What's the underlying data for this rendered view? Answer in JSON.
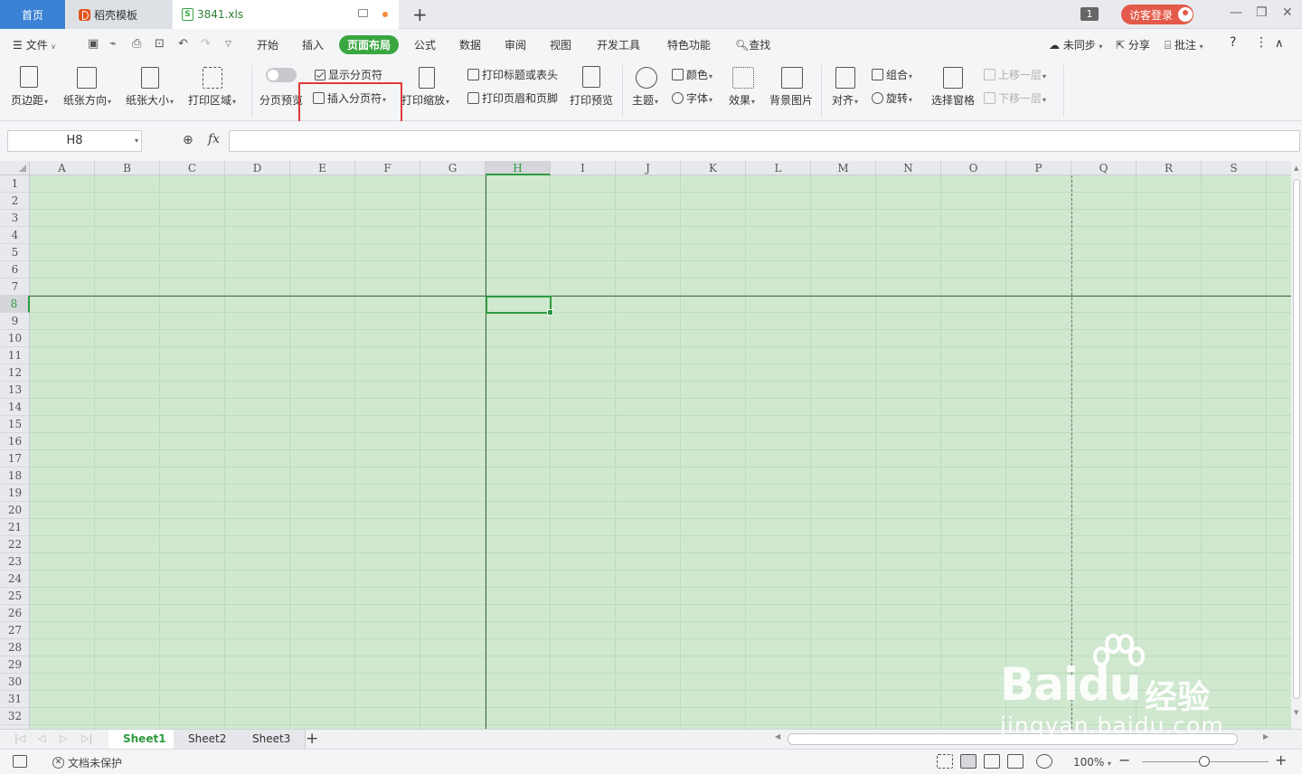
{
  "tabs": {
    "home": "首页",
    "template": "稻壳模板",
    "document": "3841.xls",
    "window_count": "1",
    "login": "访客登录"
  },
  "menu": {
    "file": "文件",
    "items": [
      "开始",
      "插入",
      "页面布局",
      "公式",
      "数据",
      "审阅",
      "视图",
      "开发工具",
      "特色功能",
      "查找"
    ],
    "active": "页面布局",
    "right": [
      "未同步",
      "分享",
      "批注"
    ]
  },
  "ribbon": {
    "margins": "页边距",
    "orientation": "纸张方向",
    "size": "纸张大小",
    "print_area": "打印区域",
    "page_break_preview": "分页预览",
    "show_page_break": "显示分页符",
    "insert_page_break": "插入分页符",
    "print_scale": "打印缩放",
    "print_titles": "打印标题或表头",
    "header_footer": "打印页眉和页脚",
    "print_preview": "打印预览",
    "theme": "主题",
    "colors": "颜色",
    "fonts": "字体",
    "effects": "效果",
    "background": "背景图片",
    "align": "对齐",
    "group": "组合",
    "rotate": "旋转",
    "selection_pane": "选择窗格",
    "bring_forward": "上移一层",
    "send_backward": "下移一层"
  },
  "formula_bar": {
    "name_box": "H8",
    "fx": "fx",
    "value": ""
  },
  "grid": {
    "columns": [
      "A",
      "B",
      "C",
      "D",
      "E",
      "F",
      "G",
      "H",
      "I",
      "J",
      "K",
      "L",
      "M",
      "N",
      "O",
      "P",
      "Q",
      "R",
      "S"
    ],
    "rows": [
      "1",
      "2",
      "3",
      "4",
      "5",
      "6",
      "7",
      "8",
      "9",
      "10",
      "11",
      "12",
      "13",
      "14",
      "15",
      "16",
      "17",
      "18",
      "19",
      "20",
      "21",
      "22",
      "23",
      "24",
      "25",
      "26",
      "27",
      "28",
      "29",
      "30",
      "31",
      "32"
    ],
    "active_col": "H",
    "active_row": "8",
    "background_color": "#cfe8cf",
    "accent_color": "#2e9a3e"
  },
  "sheets": {
    "tabs": [
      "Sheet1",
      "Sheet2",
      "Sheet3"
    ],
    "active": "Sheet1"
  },
  "status": {
    "protection": "文档未保护",
    "zoom": "100%"
  },
  "watermark": {
    "brand": "Bai",
    "brand_suffix": "du",
    "cn": "经验",
    "url": "jingyan.baidu.com"
  }
}
